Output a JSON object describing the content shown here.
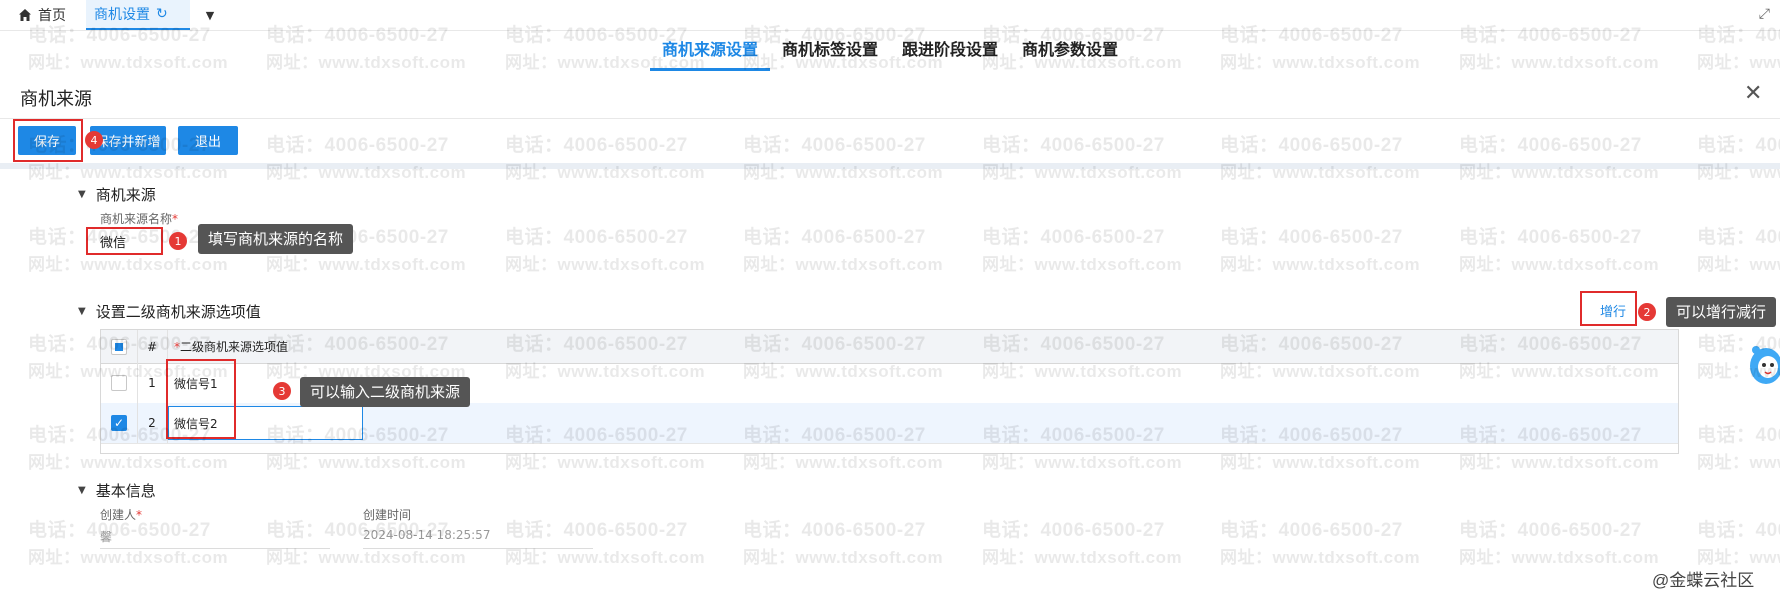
{
  "tabs": {
    "home_label": "首页",
    "active_label": "商机设置",
    "refresh_icon": "↻",
    "dropdown_icon": "▼",
    "fullscreen_icon": "⤢"
  },
  "settings_nav": {
    "items": [
      "商机来源设置",
      "商机标签设置",
      "跟进阶段设置",
      "商机参数设置"
    ],
    "active_index": 0
  },
  "dialog": {
    "title": "商机来源",
    "close_icon": "✕"
  },
  "toolbar": {
    "save_label": "保存",
    "save_new_label": "保存并新增",
    "exit_label": "退出"
  },
  "section_source": {
    "title": "商机来源",
    "name_label": "商机来源名称",
    "required_mark": "*",
    "name_value": "微信"
  },
  "section_options": {
    "title": "设置二级商机来源选项值",
    "add_row_label": "增行",
    "grid": {
      "col_index_header": "#",
      "col_value_header": "二级商机来源选项值",
      "required_mark": "*",
      "rows": [
        {
          "index": "1",
          "value": "微信号1",
          "checked": false
        },
        {
          "index": "2",
          "value": "微信号2",
          "checked": true
        }
      ]
    }
  },
  "section_basic": {
    "title": "基本信息",
    "creator_label": "创建人",
    "required_mark": "*",
    "creator_value": "馨",
    "created_time_label": "创建时间",
    "created_time_value": "2024-08-14 18:25:57"
  },
  "annotations": [
    {
      "number": "1",
      "text": "填写商机来源的名称"
    },
    {
      "number": "2",
      "text": "可以增行减行"
    },
    {
      "number": "3",
      "text": "可以输入二级商机来源"
    },
    {
      "number": "4",
      "text": ""
    }
  ],
  "watermark": {
    "phone": "电话：4006-6500-27",
    "site": "网址：www.tdxsoft.com"
  },
  "community_mark": "@金蝶云社区",
  "colors": {
    "accent": "#1e88e5",
    "highlight": "#e02b2b",
    "tooltip_bg": "#555555"
  }
}
